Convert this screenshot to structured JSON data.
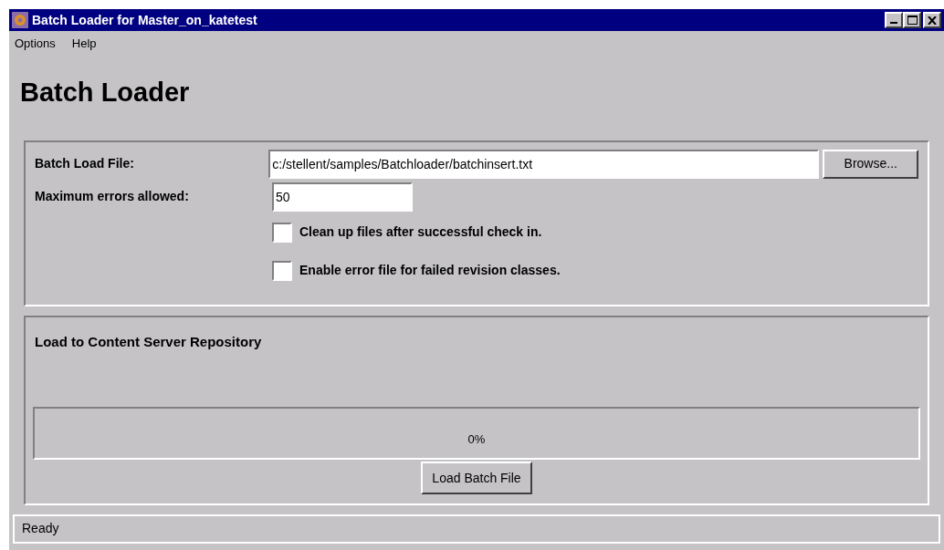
{
  "window": {
    "title": "Batch Loader for Master_on_katetest"
  },
  "menu": [
    "Options",
    "Help"
  ],
  "heading": "Batch Loader",
  "settings": {
    "file_label": "Batch Load File:",
    "file_value": "c:/stellent/samples/Batchloader/batchinsert.txt",
    "browse": "Browse...",
    "errors_label": "Maximum errors allowed:",
    "errors_value": "50",
    "checkboxes": [
      {
        "label": "Clean up files after successful check in.",
        "checked": false
      },
      {
        "label": "Enable error file for failed revision classes.",
        "checked": false
      }
    ]
  },
  "load": {
    "title": "Load to Content Server Repository",
    "progress": {
      "level": 0,
      "reading": "0%"
    },
    "button": "Load Batch File"
  },
  "status_bar": "Ready"
}
